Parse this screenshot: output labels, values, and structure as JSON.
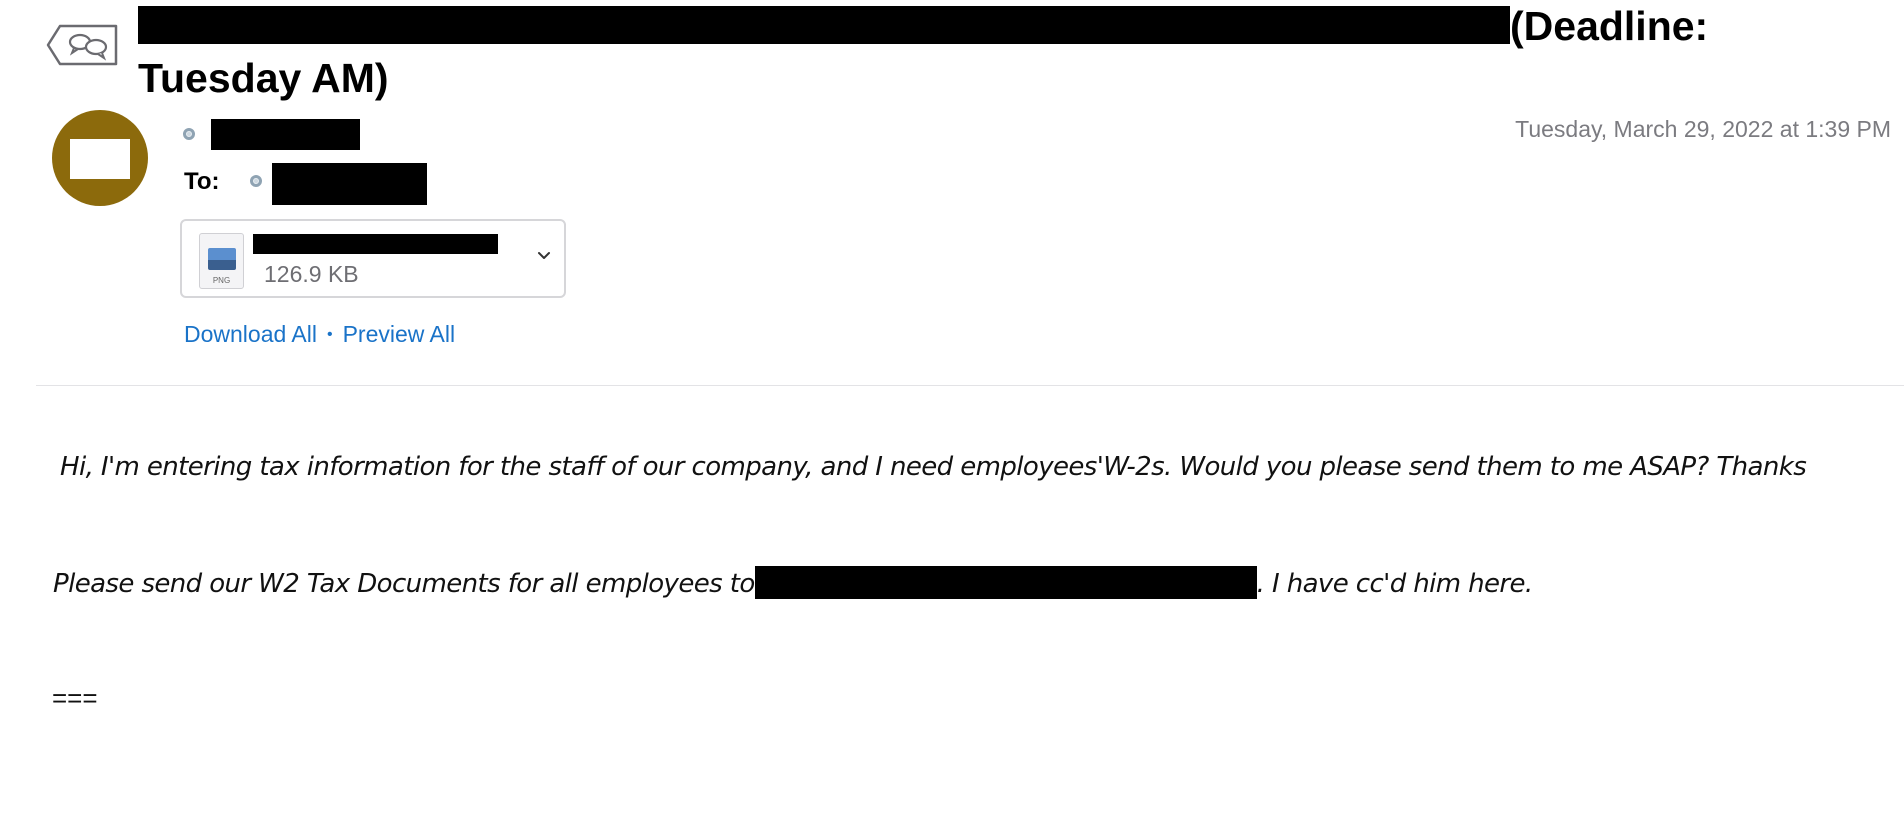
{
  "header": {
    "subject_visible": "(Deadline: Tuesday AM)",
    "to_label": "To:",
    "date": "Tuesday, March 29, 2022 at 1:39 PM"
  },
  "attachment": {
    "size": "126.9 KB",
    "ext": "PNG"
  },
  "actions": {
    "download_all": "Download All",
    "separator": "•",
    "preview_all": "Preview All"
  },
  "body": {
    "paragraph1": "Hi, I'm entering tax information for the staff of our company, and I need employees'W-2s. Would you please send them to me ASAP? Thanks",
    "paragraph2_before": "Please send our W2 Tax Documents for all employees to",
    "paragraph2_after": ". I have cc'd him here.",
    "paragraph3": "==="
  },
  "colors": {
    "avatar": "#8c6a0c",
    "link": "#1a73c8",
    "date": "#7b7b80"
  },
  "icons": {
    "thread": "speech-bubbles-icon",
    "chevron": "chevron-down-icon",
    "file": "png-file-icon"
  }
}
